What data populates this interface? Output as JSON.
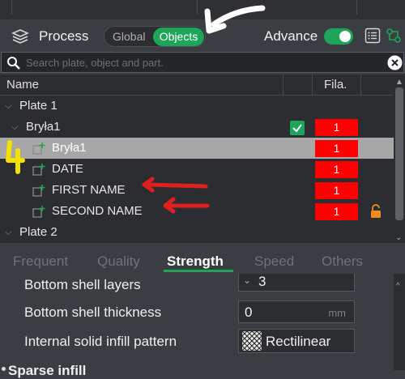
{
  "header": {
    "title": "Process",
    "mode_global": "Global",
    "mode_objects": "Objects",
    "advance_label": "Advance",
    "advance_on": true
  },
  "search": {
    "placeholder": "Search plate, object and part."
  },
  "table": {
    "columns": {
      "name": "Name",
      "fila": "Fila."
    },
    "rows": [
      {
        "label": "Plate 1"
      },
      {
        "label": "Bryła1",
        "fila": "1",
        "checked": true
      },
      {
        "label": "Bryła1",
        "fila": "1",
        "selected": true
      },
      {
        "label": "DATE",
        "fila": "1"
      },
      {
        "label": "FIRST NAME",
        "fila": "1"
      },
      {
        "label": "SECOND NAME",
        "fila": "1",
        "locked": true
      },
      {
        "label": "Plate 2"
      }
    ]
  },
  "tabs": [
    {
      "label": "Frequent"
    },
    {
      "label": "Quality"
    },
    {
      "label": "Strength",
      "active": true
    },
    {
      "label": "Speed"
    },
    {
      "label": "Others"
    }
  ],
  "settings": {
    "bottom_shell_layers": {
      "label": "Bottom shell layers",
      "value": "3"
    },
    "bottom_shell_thickness": {
      "label": "Bottom shell thickness",
      "value": "0",
      "unit": "mm"
    },
    "internal_infill_pattern": {
      "label": "Internal solid infill pattern",
      "value": "Rectilinear"
    },
    "sparse_infill": {
      "label": "Sparse infill"
    }
  },
  "annotations": {
    "handwritten_number": "4"
  },
  "colors": {
    "accent": "#1ea55a",
    "filament": "#ff0000",
    "arrow": "#e02020",
    "highlight": "#f5e100"
  }
}
